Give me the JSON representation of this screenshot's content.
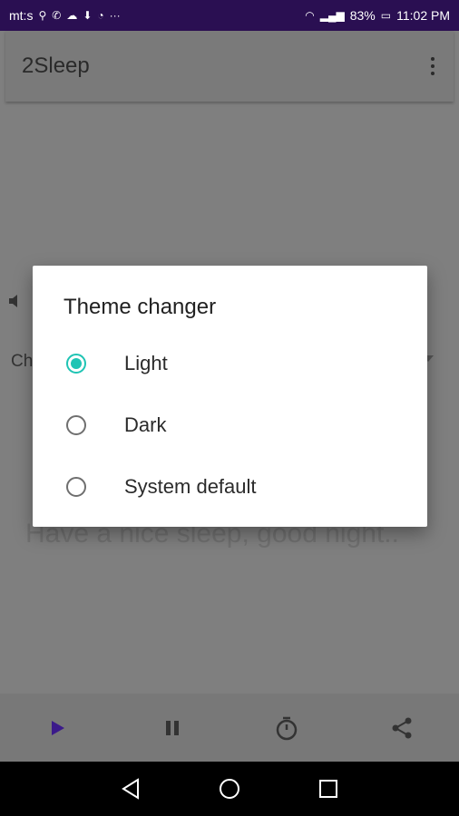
{
  "status_bar": {
    "carrier": "mt:s",
    "battery": "83%",
    "time": "11:02 PM"
  },
  "app_bar": {
    "title": "2Sleep"
  },
  "background": {
    "label_fragment": "Ch",
    "hint": "Have a nice sleep, good night.."
  },
  "dialog": {
    "title": "Theme changer",
    "options": [
      {
        "label": "Light",
        "selected": true
      },
      {
        "label": "Dark",
        "selected": false
      },
      {
        "label": "System default",
        "selected": false
      }
    ]
  },
  "colors": {
    "accent": "#1fc4b4",
    "status_bar": "#2a0f52",
    "play": "#3b1a8a"
  },
  "icons": {
    "play": "play-icon",
    "pause": "pause-icon",
    "timer": "timer-icon",
    "share": "share-icon"
  }
}
